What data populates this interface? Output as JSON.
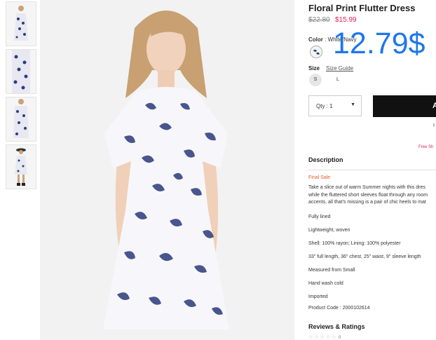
{
  "product": {
    "title": "Floral Print Flutter Dress",
    "original_price": "$22.80",
    "sale_price": "$15.99",
    "overlay_price": "12.79$"
  },
  "color": {
    "label": "Color",
    "value": "White/Navy",
    "accent": "#1f3a78"
  },
  "size": {
    "label": "Size",
    "guide_label": "Size Guide",
    "options": [
      "S",
      "L"
    ],
    "selected": "S"
  },
  "quantity": {
    "label": "Qty : 1"
  },
  "cart": {
    "button_label": "A",
    "stock_mark": "I"
  },
  "free_shipping": "Free Sh",
  "description": {
    "heading": "Description",
    "final_sale": "Final Sale",
    "paragraph_lines": [
      "Take a slice out of warm Summer nights with this dres",
      "while the fluttered short sleeves float through any room",
      "accents, all that's missing is a pair of chic heels to mat"
    ],
    "items": [
      "Fully lined",
      "Lightweight, woven",
      "Shell: 100% rayon; Lining: 100% polyester",
      "33\" full length, 36\" chest, 25\" waist, 9\" sleeve length",
      "Measured from Small",
      "Hand wash cold",
      "Imported",
      "Product Code : 2000102614"
    ]
  },
  "reviews": {
    "heading": "Reviews & Ratings",
    "stars": "☆☆☆☆☆",
    "count": "0"
  },
  "colors": {
    "sale": "#e0245e",
    "overlay": "#1f77e8",
    "button": "#111111"
  }
}
